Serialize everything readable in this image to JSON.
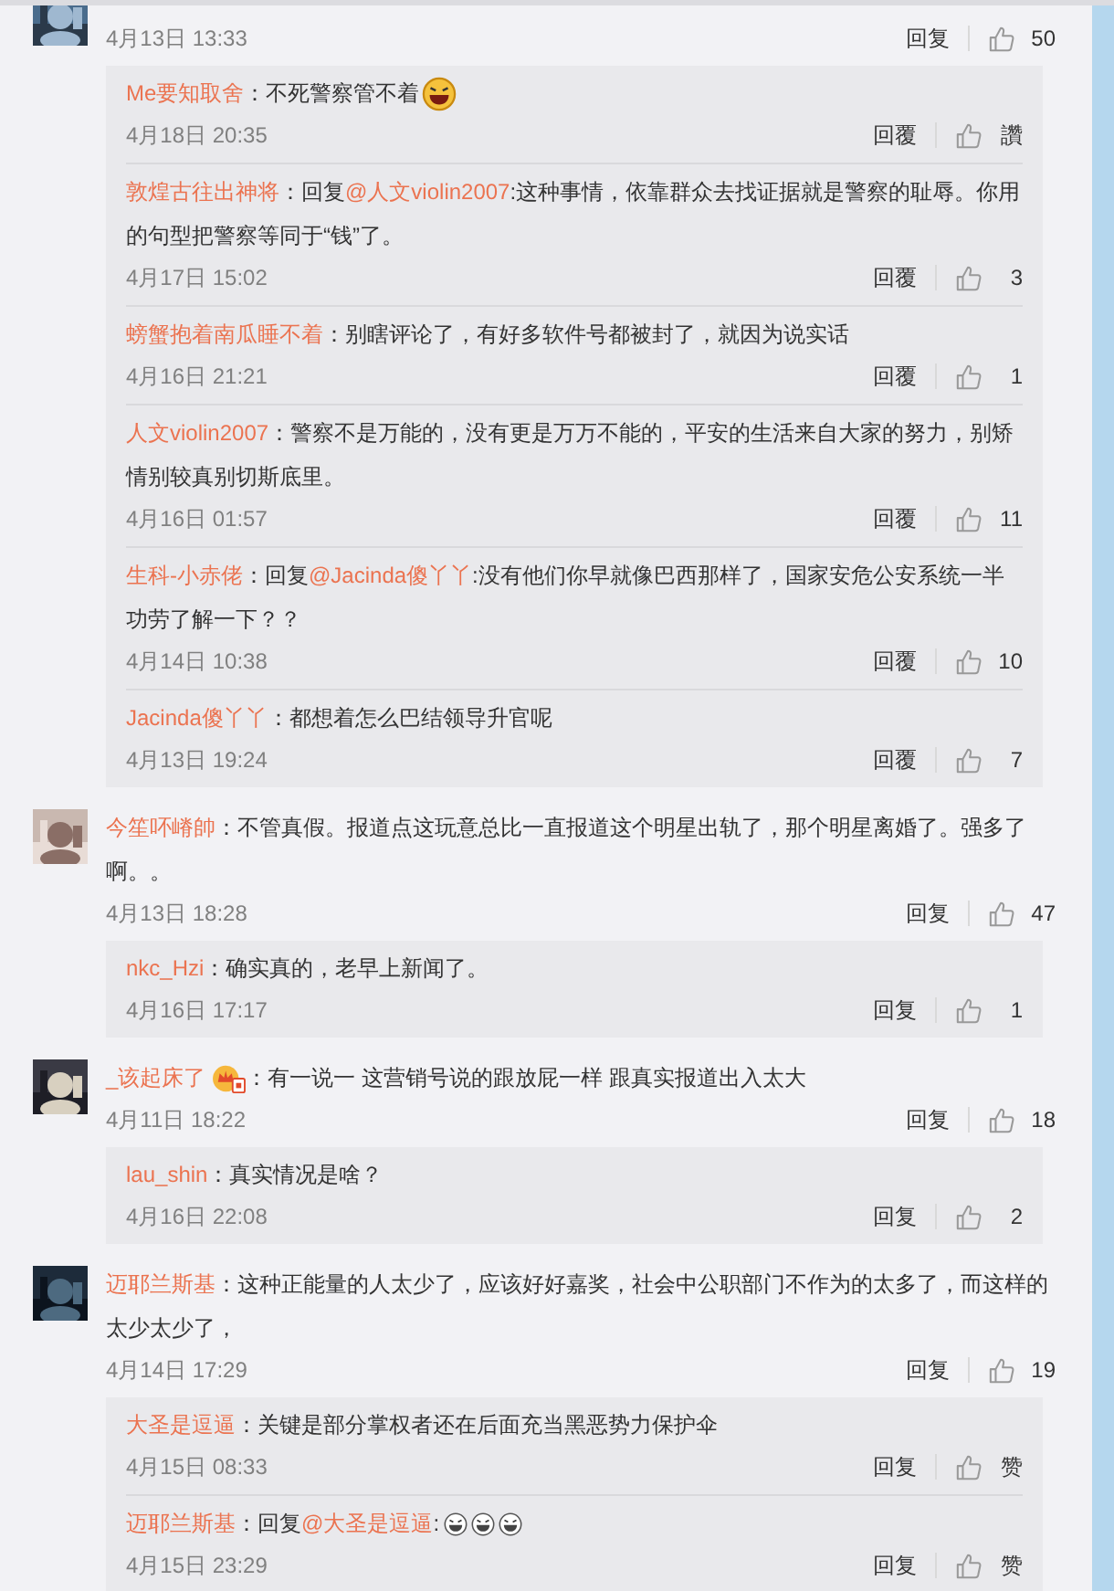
{
  "comments": [
    {
      "cut_top": true,
      "time": "4月13日 13:33",
      "reply_label": "回复",
      "likes": "50",
      "replies": [
        {
          "name": "Me要知取舍",
          "text": "：不死警察管不着",
          "emojis": [
            {
              "kind": "large"
            }
          ],
          "time": "4月18日 20:35",
          "reply_label": "回覆",
          "likes": "讚"
        },
        {
          "name": "敦煌古往出神将",
          "prefix": "：回复",
          "mention": "@人文violin2007",
          "text": ":这种事情，依靠群众去找证据就是警察的耻辱。你用的句型把警察等同于“钱”了。",
          "time": "4月17日 15:02",
          "reply_label": "回覆",
          "likes": "3"
        },
        {
          "name": "螃蟹抱着南瓜睡不着",
          "text": "：别瞎评论了，有好多软件号都被封了，就因为说实话",
          "time": "4月16日 21:21",
          "reply_label": "回覆",
          "likes": "1"
        },
        {
          "name": "人文violin2007",
          "text": "：警察不是万能的，没有更是万万不能的，平安的生活来自大家的努力，别矫情别较真别切斯底里。",
          "time": "4月16日 01:57",
          "reply_label": "回覆",
          "likes": "11"
        },
        {
          "name": "生科-小赤佬",
          "prefix": "：回复",
          "mention": "@Jacinda傻丫丫",
          "text": ":没有他们你早就像巴西那样了，国家安危公安系统一半功劳了解一下？？",
          "time": "4月14日 10:38",
          "reply_label": "回覆",
          "likes": "10"
        },
        {
          "name": "Jacinda傻丫丫",
          "text": "：都想着怎么巴结领导升官呢",
          "time": "4月13日 19:24",
          "reply_label": "回覆",
          "likes": "7"
        }
      ]
    },
    {
      "name": "今笙吥嵴帥",
      "text": "：不管真假。报道点这玩意总比一直报道这个明星出轨了，那个明星离婚了。强多了啊。。",
      "time": "4月13日 18:28",
      "reply_label": "回复",
      "likes": "47",
      "replies": [
        {
          "name": "nkc_Hzi",
          "text": "：确实真的，老早上新闻了。",
          "time": "4月16日 17:17",
          "reply_label": "回复",
          "likes": "1"
        }
      ]
    },
    {
      "name": "_该起床了",
      "badge": true,
      "text": "：有一说一 这营销号说的跟放屁一样 跟真实报道出入太大",
      "time": "4月11日 18:22",
      "reply_label": "回复",
      "likes": "18",
      "replies": [
        {
          "name": "lau_shin",
          "text": "：真实情况是啥？",
          "time": "4月16日 22:08",
          "reply_label": "回复",
          "likes": "2"
        }
      ]
    },
    {
      "name": "迈耶兰斯基",
      "text": "：这种正能量的人太少了，应该好好嘉奖，社会中公职部门不作为的太多了，而这样的太少太少了，",
      "time": "4月14日 17:29",
      "reply_label": "回复",
      "likes": "19",
      "replies": [
        {
          "name": "大圣是逗逼",
          "text": "：关键是部分掌权者还在后面充当黑恶势力保护伞",
          "time": "4月15日 08:33",
          "reply_label": "回复",
          "likes": "赞"
        },
        {
          "name": "迈耶兰斯基",
          "prefix": "：回复",
          "mention": "@大圣是逗逼",
          "text": ":",
          "emojis": [
            {
              "kind": "small"
            },
            {
              "kind": "small"
            },
            {
              "kind": "small"
            }
          ],
          "time": "4月15日 23:29",
          "reply_label": "回复",
          "likes": "赞"
        }
      ]
    }
  ]
}
